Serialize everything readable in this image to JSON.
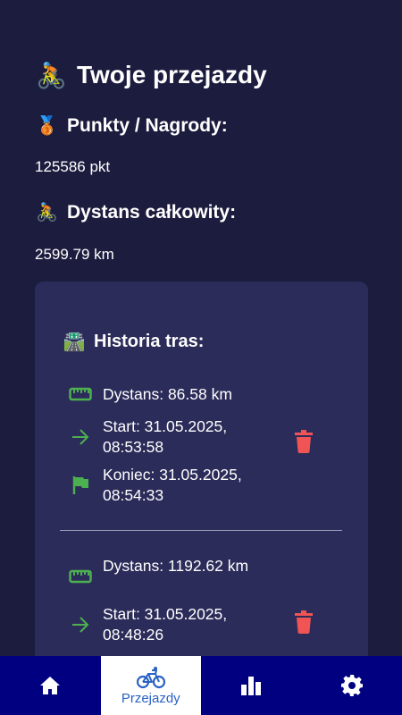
{
  "header": {
    "title": "Twoje przejazdy",
    "icon": "cyclist-emoji"
  },
  "points": {
    "label": "Punkty / Nagrody:",
    "value": "125586 pkt",
    "icon": "medal-emoji"
  },
  "distance": {
    "label": "Dystans całkowity:",
    "value": "2599.79 km",
    "icon": "cyclist-emoji"
  },
  "history": {
    "title": "Historia tras:",
    "icon": "road-emoji",
    "rides": [
      {
        "distance": "Dystans: 86.58 km",
        "start": "Start: 31.05.2025, 08:53:58",
        "end": "Koniec: 31.05.2025, 08:54:33"
      },
      {
        "distance": "Dystans: 1192.62 km",
        "start": "Start: 31.05.2025, 08:48:26",
        "end": ""
      }
    ]
  },
  "nav": {
    "items": [
      {
        "label": "",
        "icon": "home-icon"
      },
      {
        "label": "Przejazdy",
        "icon": "bicycle-icon",
        "active": true
      },
      {
        "label": "",
        "icon": "bar-chart-icon"
      },
      {
        "label": "",
        "icon": "gear-icon"
      }
    ]
  },
  "colors": {
    "background": "#1c1c3e",
    "card": "#2c2c5a",
    "green": "#4caf50",
    "delete": "#f05454",
    "nav": "#000080",
    "nav_active_text": "#2962c4"
  }
}
